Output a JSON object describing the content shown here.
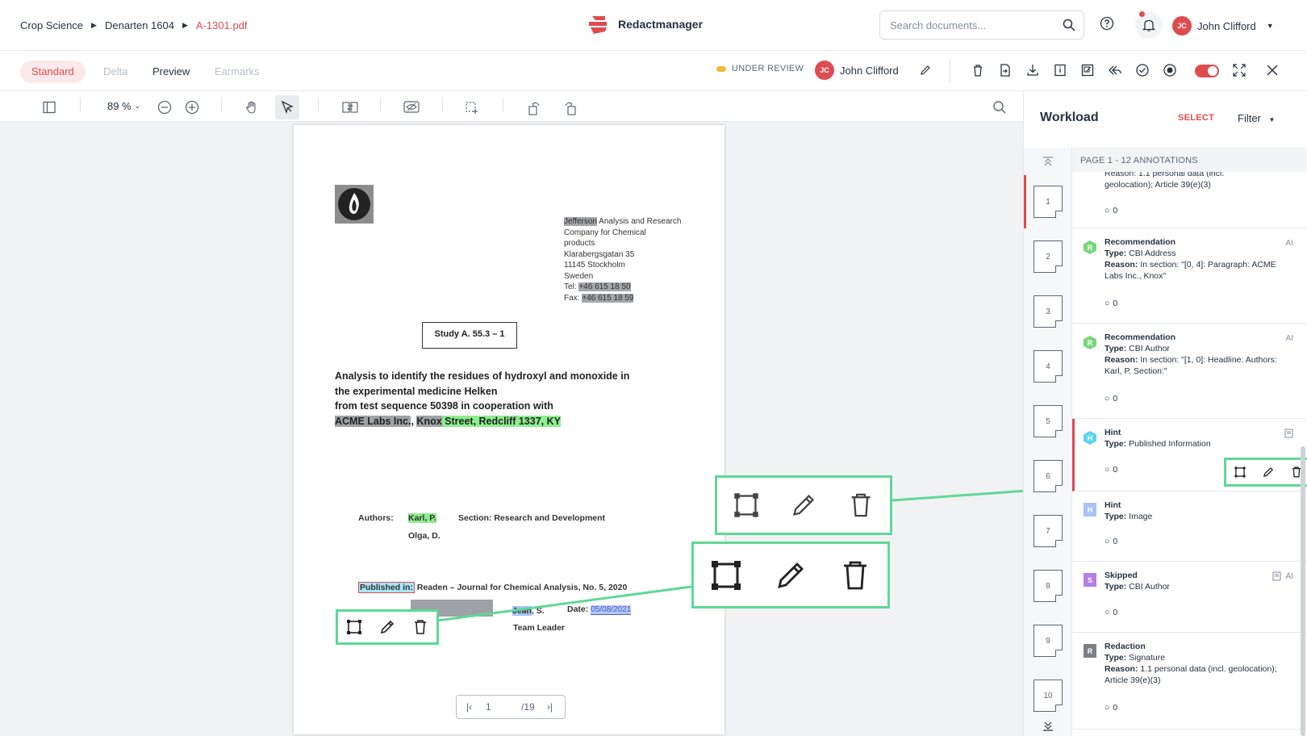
{
  "breadcrumb": {
    "items": [
      "Crop Science",
      "Denarten 1604"
    ],
    "current": "A-1301.pdf"
  },
  "app": {
    "name": "Redactmanager"
  },
  "search": {
    "placeholder": "Search documents..."
  },
  "user": {
    "initials": "JC",
    "name": "John Clifford"
  },
  "tabs": [
    {
      "label": "Standard",
      "state": "active"
    },
    {
      "label": "Delta",
      "state": "disabled"
    },
    {
      "label": "Preview",
      "state": "normal"
    },
    {
      "label": "Earmarks",
      "state": "disabled"
    }
  ],
  "status": {
    "label": "UNDER REVIEW",
    "color": "#f5b83d"
  },
  "reviewer": {
    "initials": "JC",
    "name": "John Clifford"
  },
  "viewer": {
    "zoom": "89 %",
    "page_current": "1",
    "page_total": "/19"
  },
  "document": {
    "address": {
      "lines": [
        [
          "Jefferson",
          " Analysis and Research"
        ],
        [
          "Company for Chemical"
        ],
        [
          "products"
        ],
        [
          "Klarabergsgatan 35"
        ],
        [
          "11145 Stockholm"
        ],
        [
          "Sweden"
        ],
        [
          "Tel: ",
          "+46 615 18 50"
        ],
        [
          "Fax: ",
          "+46 615 18 59"
        ]
      ]
    },
    "study": "Study A. 55.3 – 1",
    "title_lines": [
      "Analysis to identify the residues of hydroxyl and monoxide in",
      "the experimental medicine Helken",
      "from test sequence 50398 in cooperation with"
    ],
    "title_last": {
      "a": "ACME Labs Inc.",
      "b": ", ",
      "c": "Knox",
      "d": " Street, Redcliff 1337, KY"
    },
    "authors_label": "Authors:",
    "author1": "Karl, P.",
    "author2": "Olga, D.",
    "section": "Section: Research and Development",
    "published_in": "Published in:",
    "published_rest": " Readen – Journal for Chemical Analysis, No. 5, 2020",
    "jean": "Jean",
    "jean_rest": ", S.",
    "date_label": "Date:",
    "date_value": "05/08/2021",
    "team_leader": "Team Leader"
  },
  "workload": {
    "title": "Workload",
    "select": "SELECT",
    "filter": "Filter",
    "page_header": "PAGE 1 - 12 ANNOTATIONS",
    "pages": [
      "1",
      "2",
      "3",
      "4",
      "5",
      "6",
      "7",
      "8",
      "9",
      "10"
    ]
  },
  "annotations": [
    {
      "top_cut": "Reason: 1.1 personal data (incl.",
      "line2": "geolocation); Article 39(e)(3)",
      "comments": "0"
    },
    {
      "badge": "R",
      "badge_color": "#7bd67b",
      "title": "Recommendation",
      "type_label": "Type:",
      "type": "CBI Address",
      "reason_label": "Reason:",
      "reason": "In section: \"[0, 4]: Paragraph: ACME Labs Inc., Knox\"",
      "ai": "AI",
      "comments": "0"
    },
    {
      "badge": "R",
      "badge_color": "#7bd67b",
      "title": "Recommendation",
      "type_label": "Type:",
      "type": "CBI Author",
      "reason_label": "Reason:",
      "reason": "In section: \"[1, 0]: Headline: Authors: Karl, P. Section:\"",
      "ai": "AI",
      "comments": "0"
    },
    {
      "badge": "H",
      "badge_color": "#5bd4ef",
      "title": "Hint",
      "type_label": "Type:",
      "type": "Published Information",
      "comments": "0"
    },
    {
      "badge": "H",
      "badge_color": "#a9c3f5",
      "title": "Hint",
      "type_label": "Type:",
      "type": "Image",
      "comments": "0"
    },
    {
      "badge": "S",
      "badge_color": "#b57ee6",
      "title": "Skipped",
      "type_label": "Type:",
      "type": "CBI Author",
      "ai": "AI",
      "comments": "0"
    },
    {
      "badge": "R",
      "badge_color": "#7b8088",
      "title": "Redaction",
      "type_label": "Type:",
      "type": "Signature",
      "reason_label": "Reason:",
      "reason": "1.1 personal data (incl. geolocation); Article 39(e)(3)",
      "comments": "0"
    }
  ]
}
